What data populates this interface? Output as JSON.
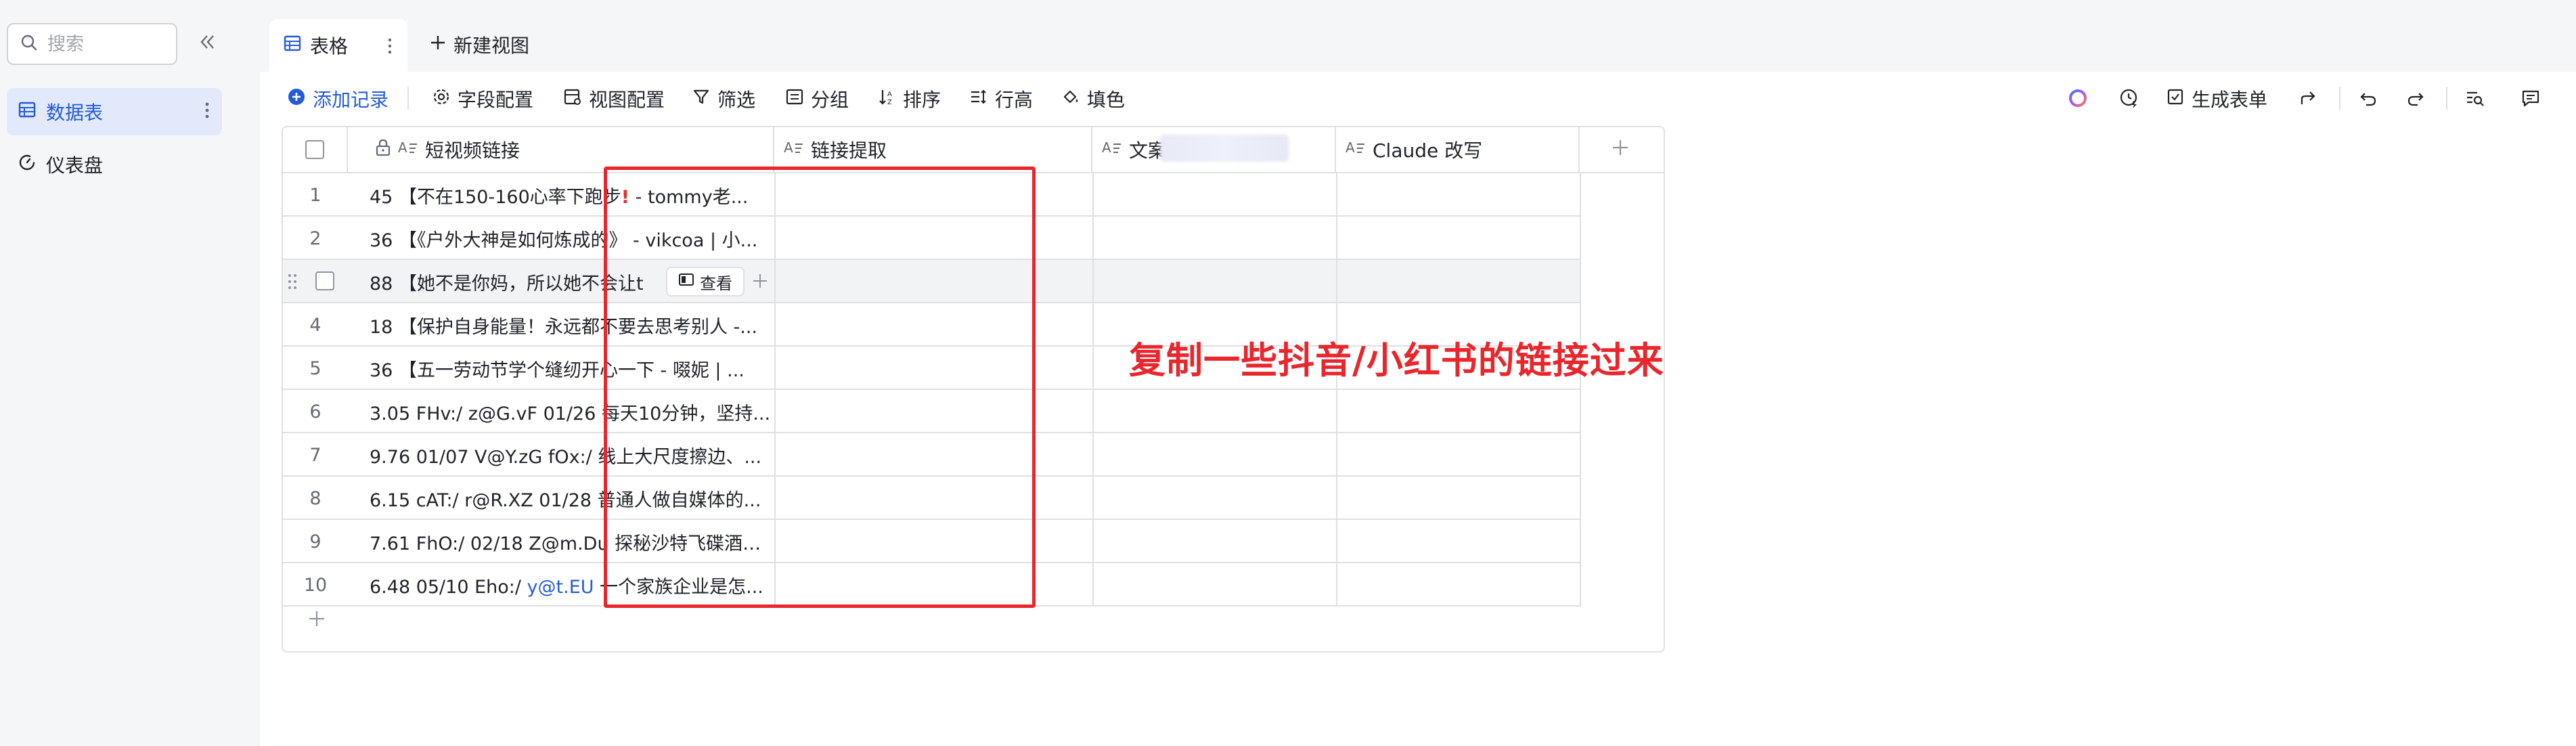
{
  "sidebar": {
    "search_placeholder": "搜索",
    "items": [
      {
        "label": "数据表"
      },
      {
        "label": "仪表盘"
      }
    ]
  },
  "tabs": {
    "active_label": "表格",
    "new_view_label": "新建视图"
  },
  "toolbar": {
    "add_record": "添加记录",
    "field_config": "字段配置",
    "view_config": "视图配置",
    "filter": "筛选",
    "group": "分组",
    "sort": "排序",
    "row_height": "行高",
    "fill_color": "填色",
    "generate_form": "生成表单"
  },
  "table": {
    "columns": [
      {
        "label": "短视频链接"
      },
      {
        "label": "链接提取"
      },
      {
        "label": "文案提取"
      },
      {
        "label": "Claude 改写"
      }
    ],
    "rows": [
      {
        "num": "1",
        "text": "45 【不在150-160心率下跑步",
        "tail": " - tommy老..."
      },
      {
        "num": "2",
        "text": "36 【《户外大神是如何炼成的》 - vikcoa | 小..."
      },
      {
        "num": "3",
        "text": "88 【她不是你妈，所以她不会让t"
      },
      {
        "num": "4",
        "text": "18 【保护自身能量！永远都不要去思考别人 -..."
      },
      {
        "num": "5",
        "text": "36 【五一劳动节学个缝纫开心一下 - 啜妮 | ..."
      },
      {
        "num": "6",
        "text": "3.05 FHv:/ z@G.vF 01/26 每天10分钟，坚持..."
      },
      {
        "num": "7",
        "text": "9.76 01/07 V@Y.zG fOx:/ 线上大尺度擦边、..."
      },
      {
        "num": "8",
        "text": "6.15 cAT:/ r@R.XZ 01/28 普通人做自媒体的..."
      },
      {
        "num": "9",
        "text": "7.61 FhO:/ 02/18 Z@m.Du 探秘沙特飞碟酒店..."
      },
      {
        "num": "10",
        "text": "6.48 05/10 Eho:/ ",
        "link": "y@t.EU",
        "tail": " 一个家族企业是怎..."
      }
    ],
    "view_button": "查看"
  },
  "annotation": "复制一些抖音/小红书的链接过来",
  "colors": {
    "accent": "#245bdb",
    "annotation_red": "#e8262c",
    "border": "#dee0e3"
  }
}
